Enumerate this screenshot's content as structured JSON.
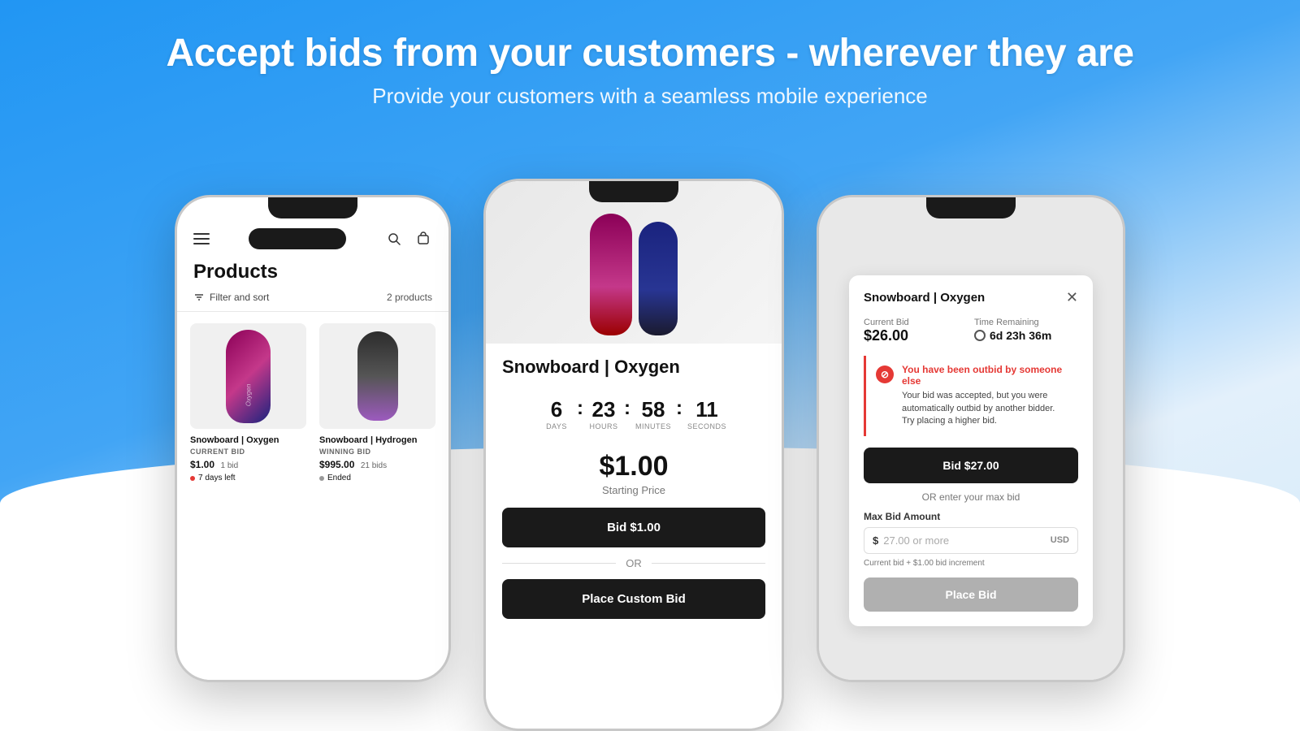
{
  "header": {
    "title": "Accept bids from your customers - wherever they are",
    "subtitle": "Provide your customers with a seamless mobile experience"
  },
  "phone1": {
    "title": "Products",
    "filter_label": "Filter and sort",
    "product_count": "2 products",
    "product1": {
      "name": "Snowboard | Oxygen",
      "bid_label": "CURRENT BID",
      "price": "$1.00",
      "bids": "1 bid",
      "status": "7 days left",
      "status_type": "active"
    },
    "product2": {
      "name": "Snowboard | Hydrogen",
      "bid_label": "WINNING BID",
      "price": "$995.00",
      "bids": "21 bids",
      "status": "Ended",
      "status_type": "ended"
    }
  },
  "phone2": {
    "product_title": "Snowboard | Oxygen",
    "countdown": {
      "days": "6",
      "hours": "23",
      "minutes": "58",
      "seconds": "11",
      "days_label": "DAYS",
      "hours_label": "HOURS",
      "minutes_label": "MINUTES",
      "seconds_label": "SECONDS"
    },
    "price": "$1.00",
    "price_sub": "Starting Price",
    "bid_btn": "Bid $1.00",
    "or_text": "OR",
    "custom_bid_btn": "Place Custom Bid"
  },
  "phone3": {
    "panel_title": "Snowboard | Oxygen",
    "current_bid_label": "Current Bid",
    "current_bid_value": "$26.00",
    "time_remaining_label": "Time Remaining",
    "time_remaining_value": "6d 23h 36m",
    "alert": {
      "title": "You have been outbid by someone else",
      "body": "Your bid was accepted, but you were automatically outbid by another bidder. Try placing a higher bid."
    },
    "bid_btn": "Bid $27.00",
    "or_enter_text": "OR enter your max bid",
    "max_bid_label": "Max Bid Amount",
    "max_bid_placeholder": "27.00 or more",
    "currency": "USD",
    "increment_note": "Current bid + $1.00 bid increment",
    "place_bid_btn": "Place Bid"
  },
  "icons": {
    "hamburger": "☰",
    "search": "🔍",
    "cart": "🛒",
    "filter": "⊟",
    "close": "✕",
    "clock": "⏱",
    "no_entry": "⊘"
  }
}
